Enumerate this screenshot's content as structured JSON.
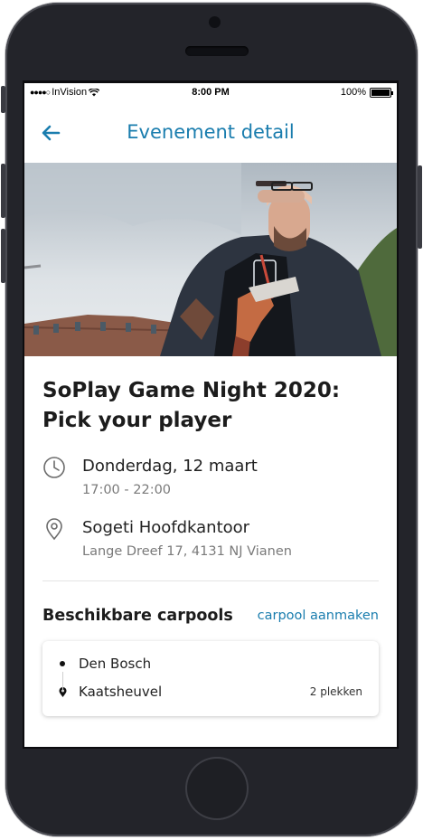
{
  "status_bar": {
    "carrier": "InVision",
    "time": "8:00 PM",
    "battery": "100%"
  },
  "header": {
    "title": "Evenement detail",
    "back_icon": "arrow-left-icon"
  },
  "event": {
    "title_line1": "SoPlay Game Night 2020:",
    "title_line2": "Pick your player",
    "date": "Donderdag, 12 maart",
    "time": "17:00 - 22:00",
    "location_name": "Sogeti Hoofdkantoor",
    "location_address": "Lange Dreef 17, 4131 NJ Vianen"
  },
  "carpools": {
    "heading": "Beschikbare carpools",
    "create_label": "carpool aanmaken",
    "items": [
      {
        "from": "Den Bosch",
        "to": "Kaatsheuvel",
        "seats": "2 plekken"
      }
    ]
  },
  "colors": {
    "accent": "#1a7dae",
    "text": "#1c1c1c",
    "muted": "#7a7a7a"
  }
}
